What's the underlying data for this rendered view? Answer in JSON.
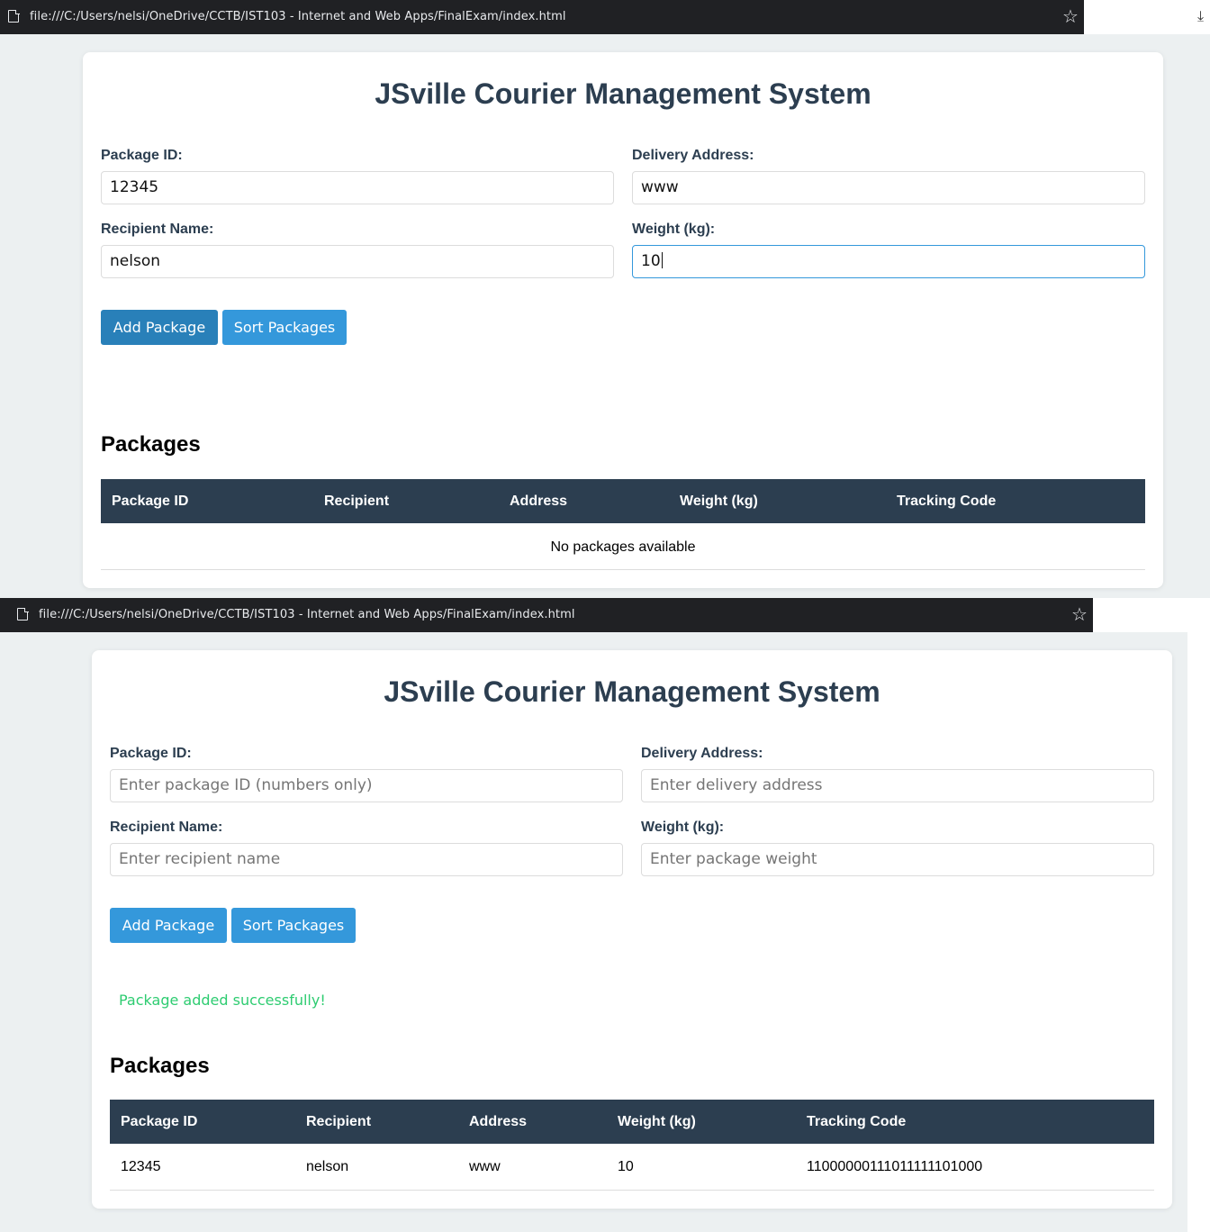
{
  "browser": {
    "url": "file:///C:/Users/nelsi/OneDrive/CCTB/IST103 - Internet and Web Apps/FinalExam/index.html",
    "bookmark_icon": "star-icon",
    "download_icon": "download-icon",
    "page_icon": "page-icon"
  },
  "app": {
    "title": "JSville Courier Management System",
    "labels": {
      "package_id": "Package ID:",
      "delivery_address": "Delivery Address:",
      "recipient_name": "Recipient Name:",
      "weight": "Weight (kg):"
    },
    "placeholders": {
      "package_id": "Enter package ID (numbers only)",
      "delivery_address": "Enter delivery address",
      "recipient_name": "Enter recipient name",
      "weight": "Enter package weight"
    },
    "buttons": {
      "add": "Add Package",
      "sort": "Sort Packages"
    },
    "packages_heading": "Packages",
    "table_headers": [
      "Package ID",
      "Recipient",
      "Address",
      "Weight (kg)",
      "Tracking Code"
    ],
    "empty_message": "No packages available"
  },
  "state_before": {
    "inputs": {
      "package_id": "12345",
      "delivery_address": "www",
      "recipient_name": "nelson",
      "weight": "10"
    },
    "focused_field": "weight"
  },
  "state_after": {
    "status_message": "Package added successfully!",
    "rows": [
      {
        "package_id": "12345",
        "recipient": "nelson",
        "address": "www",
        "weight": "10",
        "tracking_code": "11000000111011111101000"
      }
    ]
  },
  "colors": {
    "heading": "#2c3e50",
    "table_header_bg": "#2c3e50",
    "button": "#3498db",
    "button_active": "#2980b9",
    "success": "#2ecc71",
    "page_bg": "#ecf0f1"
  }
}
